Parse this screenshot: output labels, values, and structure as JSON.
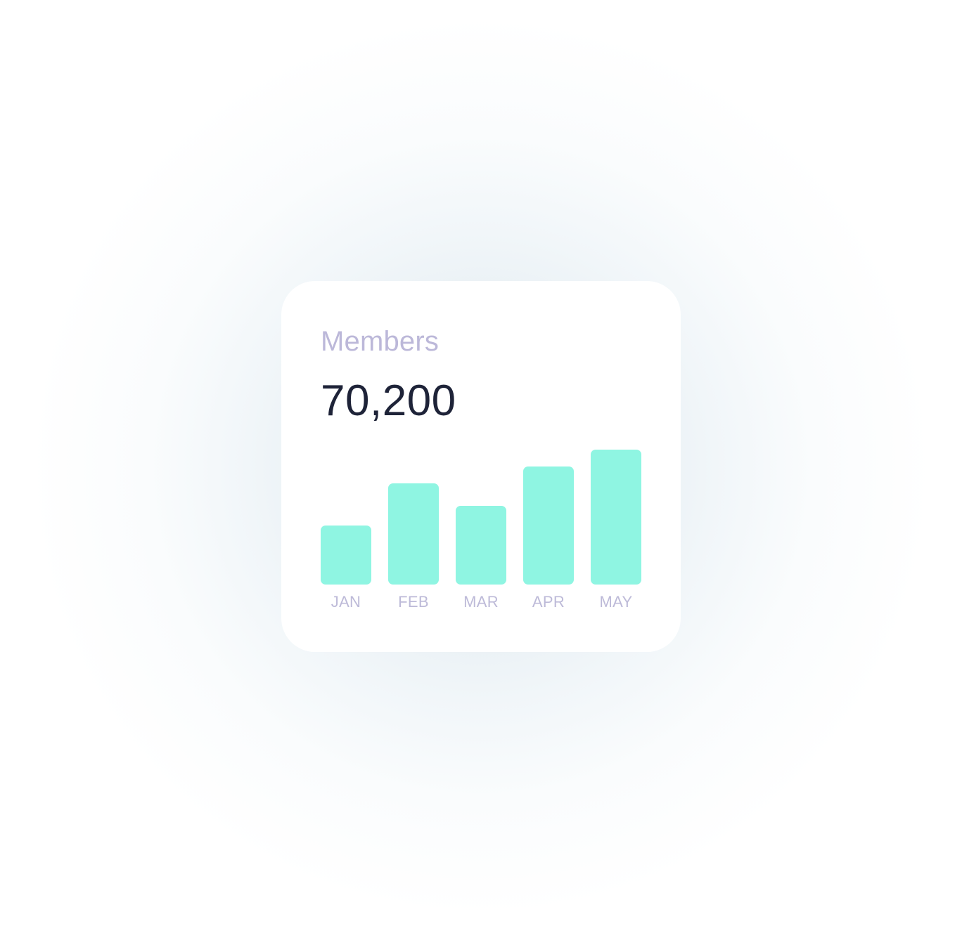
{
  "card": {
    "title": "Members",
    "value": "70,200"
  },
  "colors": {
    "bar": "#8ff5e2",
    "title": "#bcb8d9",
    "value": "#1e2338",
    "tick_label": "#bdbad8",
    "card_background": "#ffffff"
  },
  "chart_data": {
    "type": "bar",
    "categories": [
      "JAN",
      "FEB",
      "MAR",
      "APR",
      "MAY"
    ],
    "values": [
      84,
      144,
      112,
      168,
      192
    ],
    "ylim": [
      0,
      192
    ],
    "grid": false,
    "legend": "none"
  }
}
